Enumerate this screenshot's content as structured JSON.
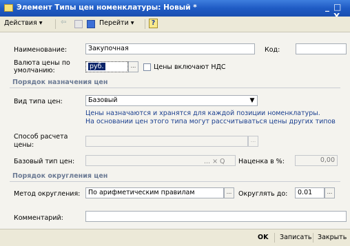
{
  "window": {
    "title": "Элемент Типы цен номенклатуры: Новый *",
    "min": "_",
    "close": "□ X"
  },
  "toolbar": {
    "actions": "Действия ▾",
    "goto": "Перейти ▾",
    "help": "?"
  },
  "form": {
    "name_label": "Наименование:",
    "name_value": "Закупочная",
    "code_label": "Код:",
    "code_value": "",
    "currency_label_1": "Валюта цены по",
    "currency_label_2": "умолчанию:",
    "currency_value": "руб.",
    "currency_btn": "...",
    "vat_label": "Цены включают НДС",
    "section1": "Порядок назначения цен",
    "price_kind_label": "Вид типа цен:",
    "price_kind_value": "Базовый",
    "note_1": "Цены назначаются и хранятся для каждой позиции номенклатуры.",
    "note_2": "На основании цен этого типа могут рассчитываться цены других типов",
    "calc_label_1": "Способ расчета",
    "calc_label_2": "цены:",
    "calc_btn": "...",
    "base_label": "Базовый тип цен:",
    "base_btns": "... × Q",
    "markup_label": "Наценка в %:",
    "markup_value": "0,00",
    "section2": "Порядок округления цен",
    "round_method_label": "Метод округления:",
    "round_method_value": "По арифметическим правилам",
    "round_method_btn": "...",
    "round_to_label": "Округлять до:",
    "round_to_value": "0.01",
    "round_to_btn": "...",
    "comment_label": "Комментарий:",
    "comment_value": ""
  },
  "bottom": {
    "ok": "OK",
    "save": "Записать",
    "close": "Закрыть"
  }
}
